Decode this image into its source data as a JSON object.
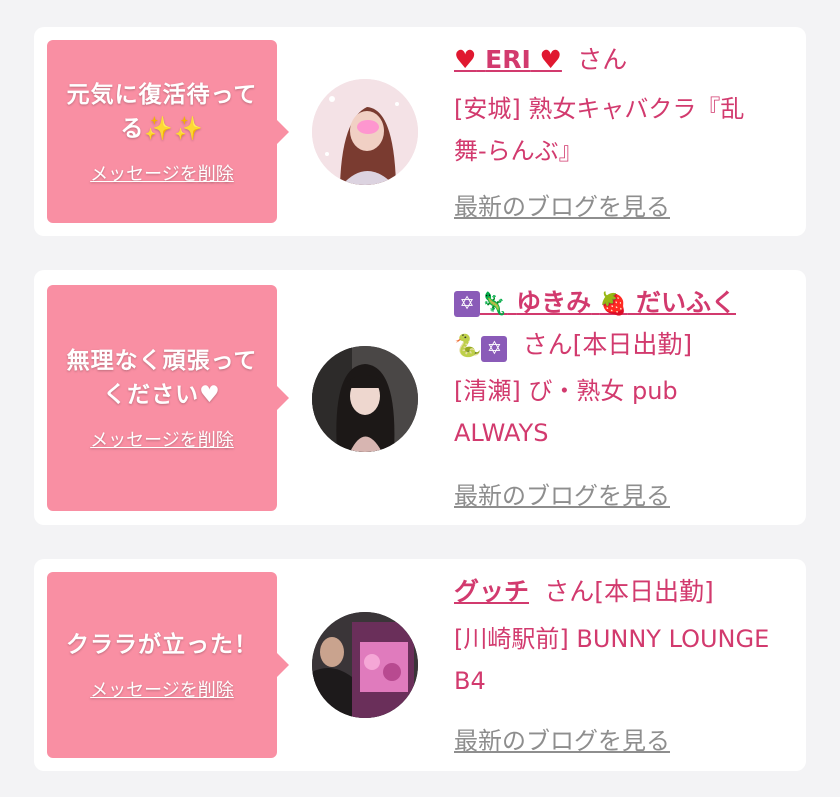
{
  "cards": [
    {
      "message": "元気に復活待ってる✨✨",
      "message_line1": "元気に復活待って",
      "message_line2": "る✨✨",
      "delete_label": "メッセージを削除",
      "name_prefix": "♥",
      "name": "ERI",
      "name_suffix": "♥",
      "honorific": "さん",
      "shop_line1": "[安城] 熟女キャバクラ『乱",
      "shop_line2": "舞-らんぶ』",
      "blog_label": "最新のブログを見る"
    },
    {
      "message": "無理なく頑張ってください♥",
      "message_line1": "無理なく頑張って",
      "message_line2": "ください♥",
      "delete_label": "メッセージを削除",
      "name_icon1": "✡",
      "name_icon2": "🦎",
      "name": "ゆきみ",
      "name_icon3": "🍓",
      "name_part2": "だいふく",
      "name_icon4": "🐍",
      "name_icon5": "✡",
      "honorific": "さん[本日出勤]",
      "shop_line1": "[清瀬] び・熟女 pub",
      "shop_line2": "ALWAYS",
      "blog_label": "最新のブログを見る"
    },
    {
      "message": "クララが立った！",
      "message_line1": "クララが立った！",
      "delete_label": "メッセージを削除",
      "name": "グッチ",
      "honorific": "さん[本日出勤]",
      "shop_line1": "[川崎駅前] BUNNY LOUNGE",
      "shop_line2": "B4",
      "blog_label": "最新のブログを見る"
    }
  ],
  "colors": {
    "bubble": "#f98fa3",
    "accent": "#d23a6e",
    "muted": "#8e8e8e",
    "background": "#f3f3f5"
  }
}
